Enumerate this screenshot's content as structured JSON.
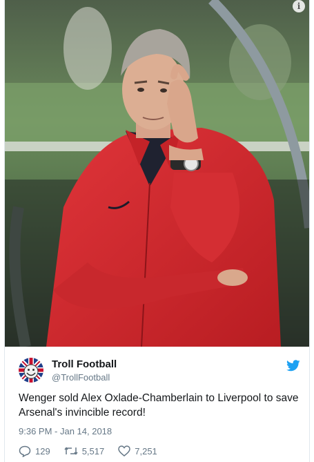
{
  "photo": {
    "subject": "man-in-red-jacket-thinking",
    "info_icon": "info-icon"
  },
  "tweet": {
    "display_name": "Troll Football",
    "handle": "@TrollFootball",
    "text": "Wenger sold Alex Oxlade-Chamberlain to Liverpool to save Arsenal's invincible record!",
    "timestamp": "9:36 PM - Jan 14, 2018",
    "avatar_icon": "union-jack-troll-face-avatar",
    "platform_icon": "twitter-bird-icon"
  },
  "actions": {
    "replies": "129",
    "retweets": "5,517",
    "likes": "7,251"
  },
  "colors": {
    "twitter_blue": "#1da1f2",
    "text": "#14171a",
    "muted": "#657786",
    "jacket_red": "#d8262b"
  }
}
